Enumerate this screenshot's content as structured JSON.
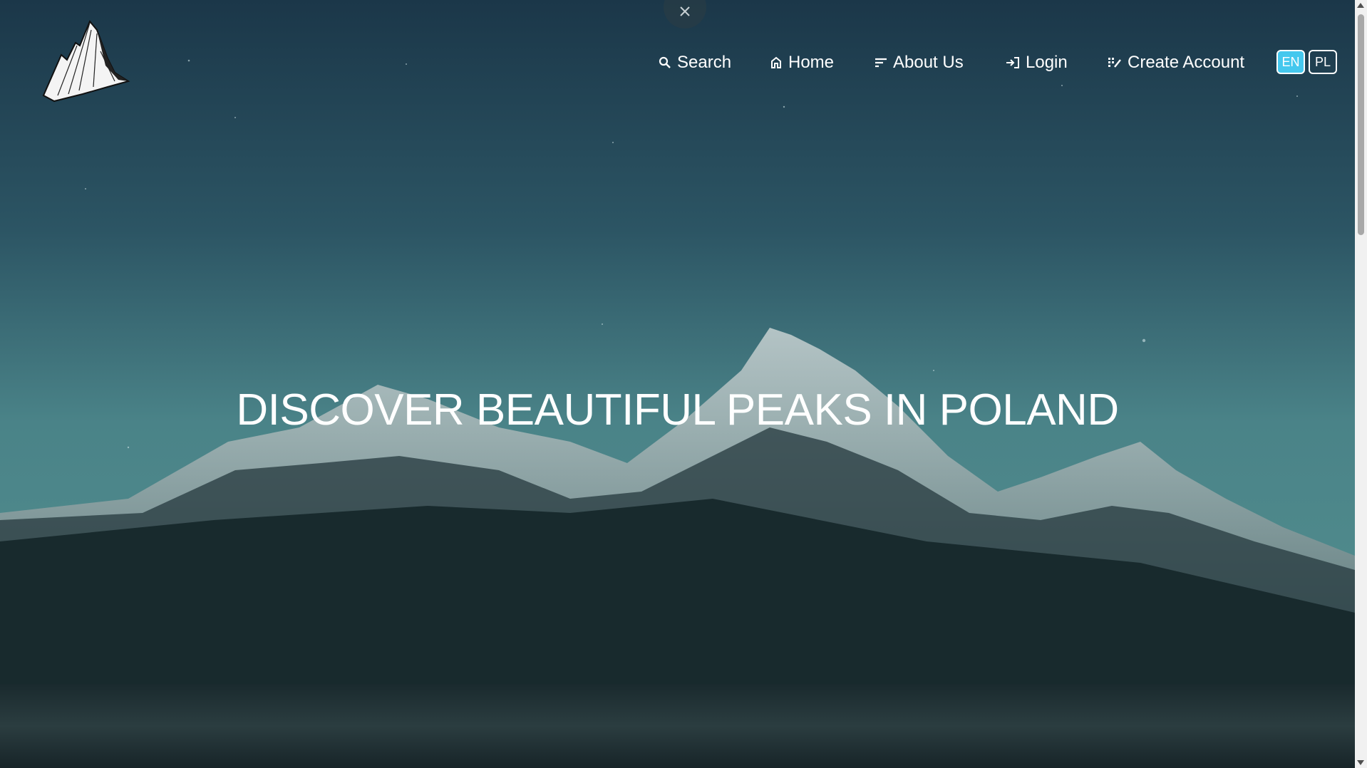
{
  "nav": {
    "items": [
      {
        "label": "Search",
        "icon": "search-icon"
      },
      {
        "label": "Home",
        "icon": "home-icon"
      },
      {
        "label": "About Us",
        "icon": "list-icon"
      },
      {
        "label": "Login",
        "icon": "login-icon"
      },
      {
        "label": "Create Account",
        "icon": "create-account-icon"
      }
    ],
    "languages": [
      {
        "label": "EN",
        "active": true
      },
      {
        "label": "PL",
        "active": false
      }
    ]
  },
  "hero": {
    "title": "DISCOVER BEAUTIFUL PEAKS IN POLAND"
  },
  "colors": {
    "accent": "#45c8ee",
    "sky_top": "#1c3a4c",
    "sky_bottom": "#4d868b"
  }
}
